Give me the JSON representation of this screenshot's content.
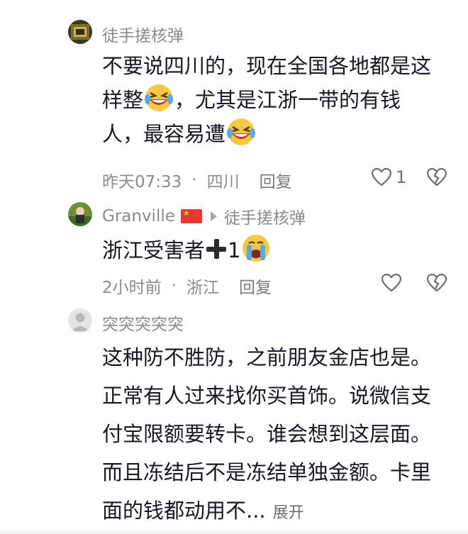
{
  "comments": [
    {
      "author": "徒手搓核弹",
      "text_line1": "不要说四川的，现在全国各地都是这",
      "text_line2a": "样整",
      "text_line2b": "，尤其是江浙一带的有钱",
      "text_line3": "人，最容易遭",
      "time": "昨天07:33",
      "location": "四川",
      "reply_label": "回复",
      "likes": "1"
    },
    {
      "author": "Granville",
      "reply_to": "徒手搓核弹",
      "text_a": "浙江受害者",
      "text_b": "1",
      "time": "2小时前",
      "location": "浙江",
      "reply_label": "回复",
      "likes": ""
    },
    {
      "author": "突突突突突",
      "text_lines": [
        "这种防不胜防，之前朋友金店也是。",
        "正常有人过来找你买首饰。说微信支",
        "付宝限额要转卡。谁会想到这层面。",
        "而且冻结后不是冻结单独金额。卡里"
      ],
      "text_last": "面的钱都动用不...",
      "expand_label": "展开"
    }
  ],
  "meta_separator": "·",
  "colors": {
    "text_primary": "#161823",
    "text_secondary": "#8a8b91",
    "flag_red": "#e8392f"
  }
}
